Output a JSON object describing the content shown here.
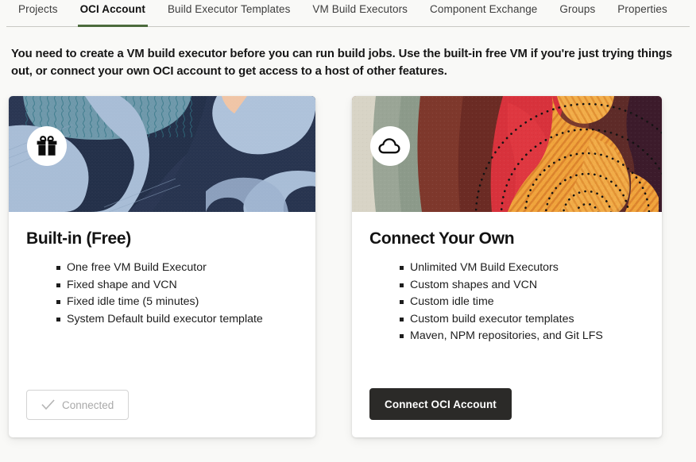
{
  "tabs": [
    {
      "label": "Projects",
      "active": false
    },
    {
      "label": "OCI Account",
      "active": true
    },
    {
      "label": "Build Executor Templates",
      "active": false
    },
    {
      "label": "VM Build Executors",
      "active": false
    },
    {
      "label": "Component Exchange",
      "active": false
    },
    {
      "label": "Groups",
      "active": false
    },
    {
      "label": "Properties",
      "active": false
    }
  ],
  "headline": "You need to create a VM build executor before you can run build jobs. Use the built-in free VM if you're just trying things out, or connect your own OCI account to get access to a host of other features.",
  "cards": [
    {
      "id": "built-in-free",
      "icon": "gift-icon",
      "title": "Built-in (Free)",
      "bullets": [
        "One free VM Build Executor",
        "Fixed shape and VCN",
        "Fixed idle time (5 minutes)",
        "System Default build executor template"
      ],
      "button": {
        "label": "Connected",
        "style": "disabled",
        "icon": "check-icon"
      }
    },
    {
      "id": "connect-your-own",
      "icon": "cloud-icon",
      "title": "Connect Your Own",
      "bullets": [
        "Unlimited VM Build Executors",
        "Custom shapes and VCN",
        "Custom idle time",
        "Custom build executor templates",
        "Maven, NPM repositories, and Git LFS"
      ],
      "button": {
        "label": "Connect OCI Account",
        "style": "primary",
        "icon": ""
      }
    }
  ],
  "colors": {
    "page_background": "#f9f9f7",
    "active_tab_indicator": "#4c6b3d",
    "primary_button": "#2b2a28",
    "card_background": "#ffffff",
    "text": "#1a1a1a",
    "disabled_text": "#a9a9a9"
  }
}
